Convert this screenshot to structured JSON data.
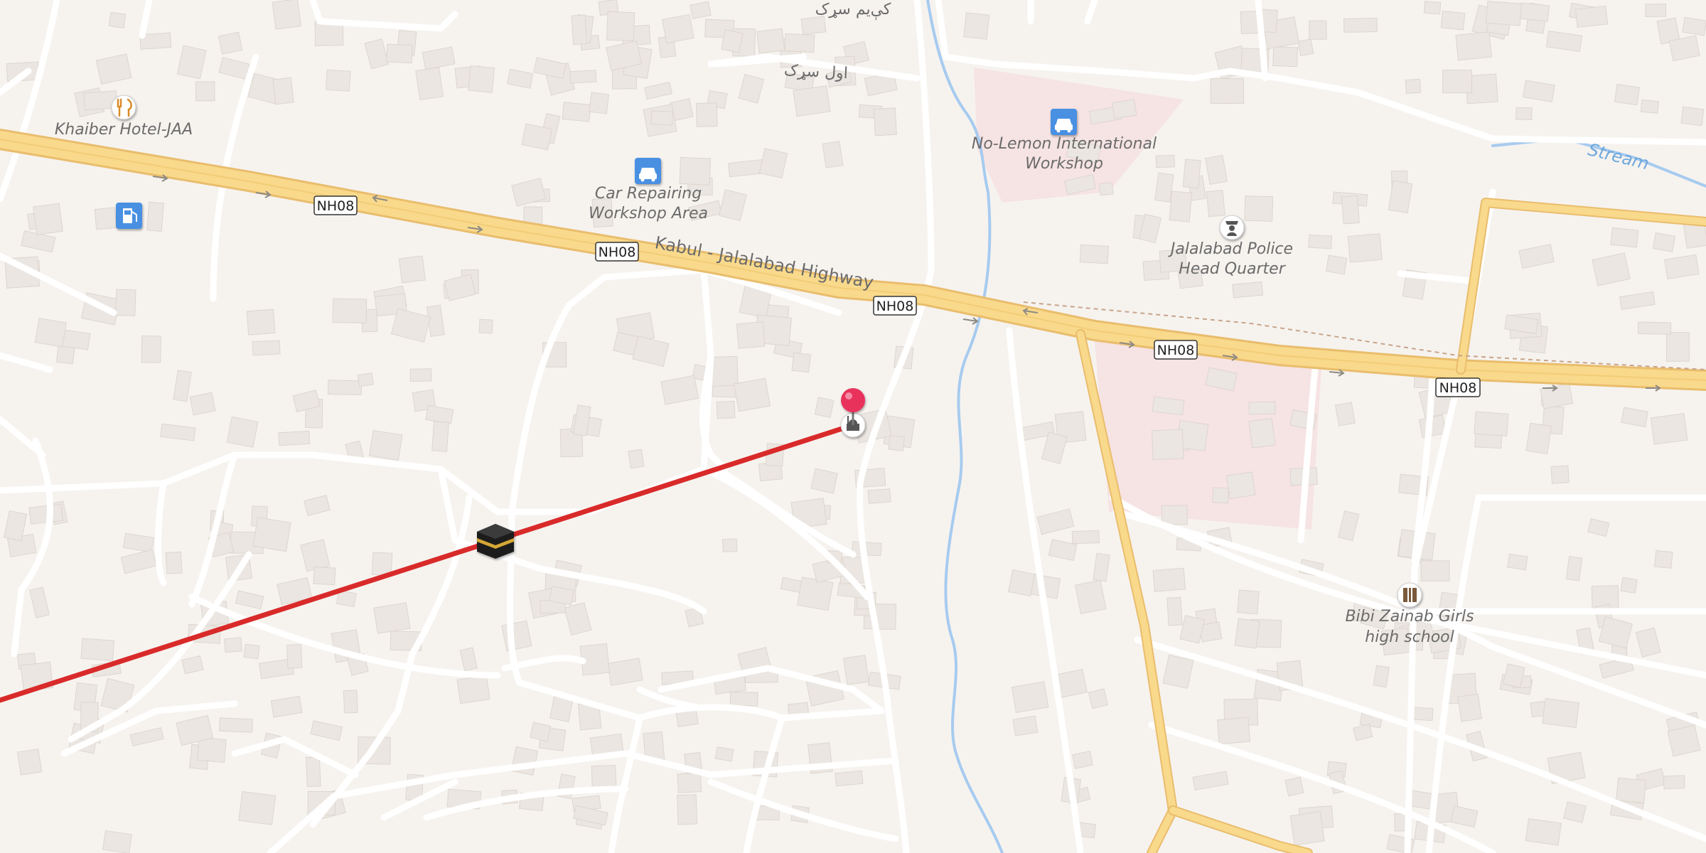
{
  "map": {
    "colors": {
      "land": "#f6f3ef",
      "building": "#ece7e2",
      "minor_road": "#ffffff",
      "highway": "#f9d98b",
      "highway_casing": "#e9bd6d",
      "water": "#a7cbef",
      "route_line": "#d92a2a",
      "pin": "#e8305c",
      "commercial_area": "#f6e3e3"
    },
    "labels": {
      "street_top": "کې‌یم سړک",
      "street_first": "اول سړک",
      "hotel": "Khaiber Hotel-JAA",
      "car_repair_line1": "Car Repairing",
      "car_repair_line2": "Workshop Area",
      "highway_name": "Kabul - Jalalabad Highway",
      "workshop_line1": "No-Lemon International",
      "workshop_line2": "Workshop",
      "police_line1": "Jalalabad Police",
      "police_line2": "Head Quarter",
      "school_line1": "Bibi Zainab Girls",
      "school_line2": "high school",
      "stream": "Stream"
    },
    "route_shield": "NH08",
    "icons": [
      "restaurant-icon",
      "fuel-icon",
      "car-icon",
      "police-icon",
      "school-icon",
      "mosque-icon",
      "kaaba-icon",
      "location-pin-icon"
    ]
  }
}
